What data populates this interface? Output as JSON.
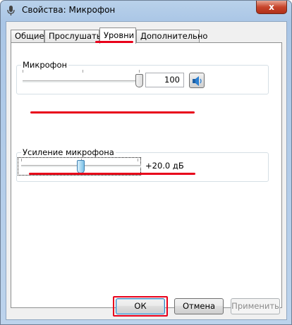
{
  "window": {
    "title": "Свойства: Микрофон",
    "close_glyph": "x"
  },
  "tabs": [
    {
      "label": "Общие",
      "active": false
    },
    {
      "label": "Прослушать",
      "active": false
    },
    {
      "label": "Уровни",
      "active": true
    },
    {
      "label": "Дополнительно",
      "active": false
    }
  ],
  "microphone": {
    "label": "Микрофон",
    "value": "100",
    "level_percent": 100,
    "mute_icon": "speaker-icon"
  },
  "boost": {
    "label": "Усиление микрофона",
    "value": "+20.0 дБ",
    "level_fraction": 0.5
  },
  "buttons": {
    "ok": "ОК",
    "cancel": "Отмена",
    "apply": "Применить"
  },
  "colors": {
    "highlight": "#e8001a",
    "thumb_active": "#7cc1e6"
  }
}
